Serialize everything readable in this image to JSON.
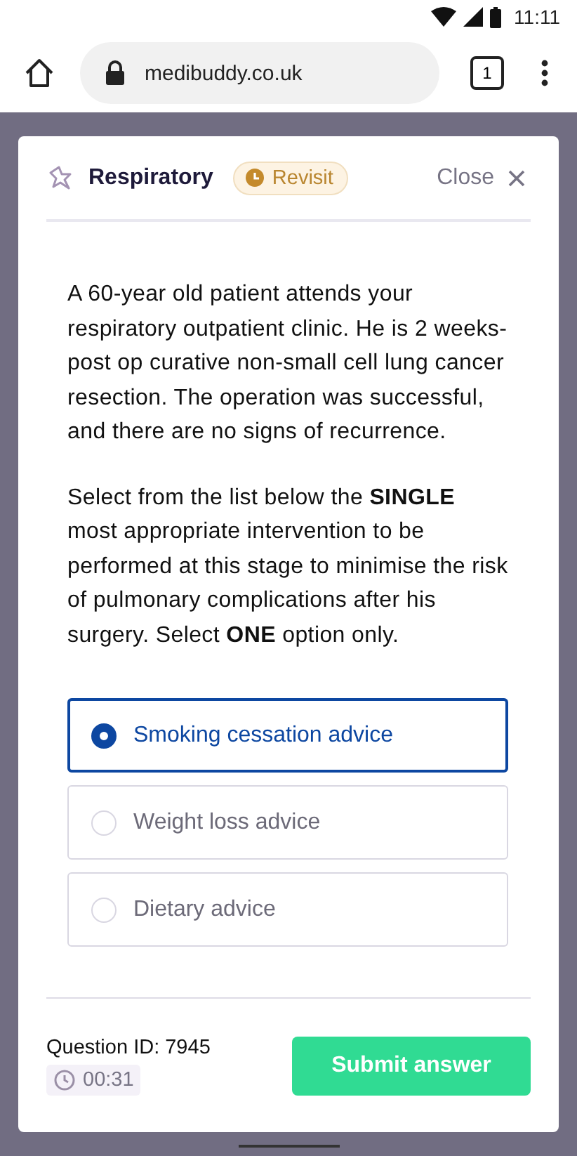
{
  "status_bar": {
    "time": "11:11"
  },
  "browser": {
    "url": "medibuddy.co.uk",
    "tab_count": "1"
  },
  "modal": {
    "category": "Respiratory",
    "badge": "Revisit",
    "close_label": "Close",
    "question": [
      "A 60-year old patient attends your respiratory outpatient clinic. He is 2 weeks-post op curative non-small cell lung cancer resection. The operation was successful, and there are no signs of recurrence.",
      "Select from the list below the **SINGLE** most appropriate intervention to be performed at this stage to minimise the risk of pulmonary complications after his surgery. Select **ONE** option only."
    ],
    "options": [
      {
        "label": "Smoking cessation advice",
        "selected": true
      },
      {
        "label": "Weight loss advice",
        "selected": false
      },
      {
        "label": "Dietary advice",
        "selected": false
      }
    ],
    "question_id": "Question ID: 7945",
    "timer": "00:31",
    "submit": "Submit answer"
  }
}
